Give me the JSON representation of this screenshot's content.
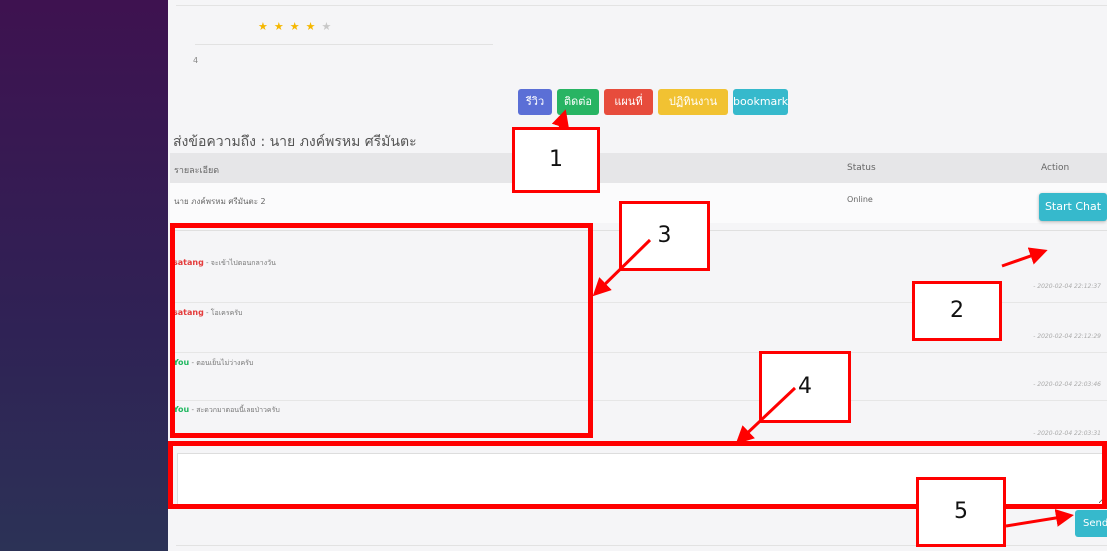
{
  "rating": {
    "stars_filled": 4,
    "stars_total": 5,
    "value": "4"
  },
  "tabs": [
    {
      "label": "รีวิว",
      "color": "#5b6fd6"
    },
    {
      "label": "ติดต่อ",
      "color": "#28b463"
    },
    {
      "label": "แผนที่",
      "color": "#e74c3c"
    },
    {
      "label": "ปฏิทินงาน",
      "color": "#f1c232"
    },
    {
      "label": "bookmark",
      "color": "#36b9cc"
    }
  ],
  "heading": "ส่งข้อความถึง : นาย ภงค์พรหม ศรีมันตะ",
  "table": {
    "headers": [
      "รายละเอียด",
      "Status",
      "Action"
    ],
    "row": {
      "name": "นาย ภงค์พรหม ศรีมันตะ 2",
      "status": "Online",
      "action": "Start Chat"
    }
  },
  "messages": [
    {
      "user": "satang",
      "text": "- จะเข้าไปตอนกลางวัน",
      "time": "- 2020-02-04 22:12:37",
      "color": "#e43b3b"
    },
    {
      "user": "satang",
      "text": "- โอเครครับ",
      "time": "- 2020-02-04 22:12:29",
      "color": "#e43b3b"
    },
    {
      "user": "You",
      "text": "- ตอนเย็นไม่ว่างครับ",
      "time": "- 2020-02-04 22:03:46",
      "color": "#20b860"
    },
    {
      "user": "You",
      "text": "- สะดวกมาตอนนี้เลยป่าวครับ",
      "time": "- 2020-02-04 22:03:31",
      "color": "#20b860"
    }
  ],
  "composer": {
    "value": "",
    "send_label": "Send"
  },
  "callouts": [
    "1",
    "2",
    "3",
    "4",
    "5"
  ],
  "annotation_color": "#ff0000"
}
